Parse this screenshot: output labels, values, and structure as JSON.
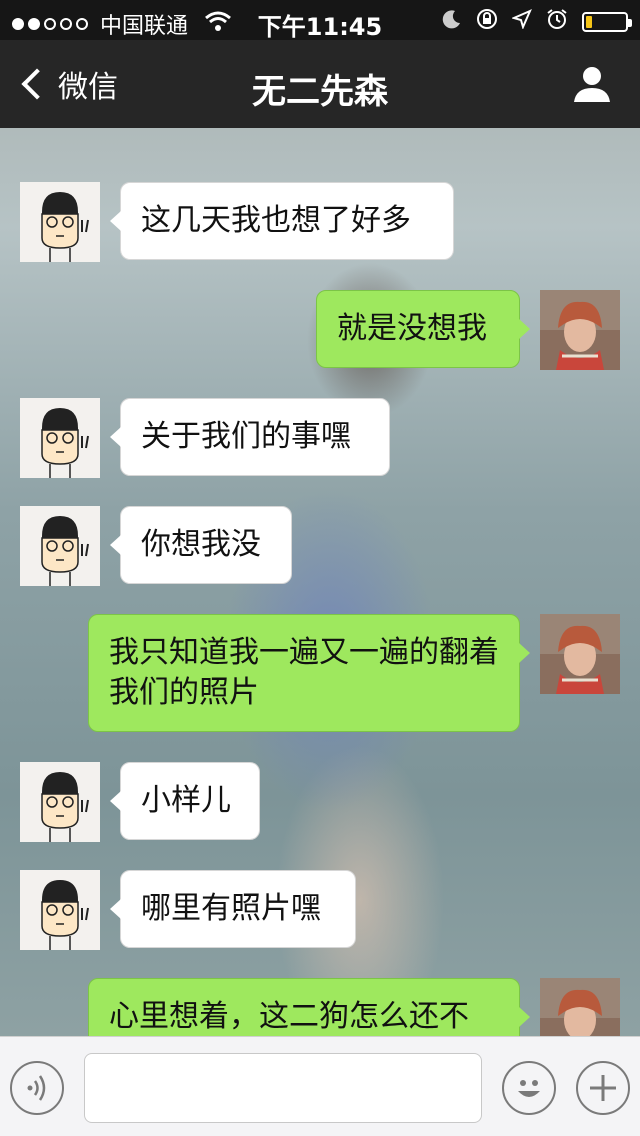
{
  "status_bar": {
    "carrier": "中国联通",
    "time": "下午11:45",
    "signal_bars_filled": 2,
    "signal_bars_total": 5,
    "battery_level": 0.15,
    "icons": [
      "wifi-icon",
      "moon-icon",
      "rotation-lock-icon",
      "location-icon",
      "alarm-icon",
      "battery-icon"
    ]
  },
  "nav": {
    "back_label": "微信",
    "title": "无二先森",
    "profile_icon": "person-icon"
  },
  "messages": [
    {
      "side": "left",
      "text": "这几天我也想了好多"
    },
    {
      "side": "right",
      "text": "就是没想我"
    },
    {
      "side": "left",
      "text": "关于我们的事嘿"
    },
    {
      "side": "left",
      "text": "你想我没"
    },
    {
      "side": "right",
      "text": "我只知道我一遍又一遍的翻着我们的照片"
    },
    {
      "side": "left",
      "text": "小样儿"
    },
    {
      "side": "left",
      "text": "哪里有照片嘿"
    },
    {
      "side": "right",
      "text": "心里想着，这二狗怎么还不"
    }
  ],
  "toolbar": {
    "input_value": "",
    "icons": [
      "voice-icon",
      "emoji-icon",
      "plus-icon"
    ]
  },
  "colors": {
    "status_bar_bg": "#161616",
    "nav_bg": "#262626",
    "bubble_sent": "#9ee85e",
    "bubble_received": "#ffffff",
    "battery": "#f5c518"
  }
}
